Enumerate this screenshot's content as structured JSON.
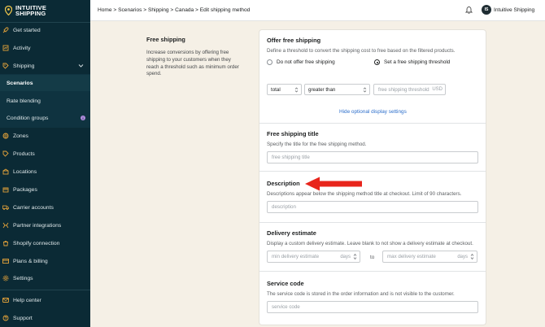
{
  "brand": {
    "line1": "INTUITIVE",
    "line2": "SHIPPING"
  },
  "sidebar": {
    "items": [
      {
        "label": "Get started",
        "icon": "rocket-icon"
      },
      {
        "label": "Activity",
        "icon": "activity-icon"
      },
      {
        "label": "Shipping",
        "icon": "shipping-icon"
      },
      {
        "label": "Scenarios"
      },
      {
        "label": "Rate blending"
      },
      {
        "label": "Condition groups",
        "badge": "i"
      },
      {
        "label": "Zones",
        "icon": "zones-icon"
      },
      {
        "label": "Products",
        "icon": "products-icon"
      },
      {
        "label": "Locations",
        "icon": "locations-icon"
      },
      {
        "label": "Packages",
        "icon": "packages-icon"
      },
      {
        "label": "Carrier accounts",
        "icon": "truck-icon"
      },
      {
        "label": "Partner integrations",
        "icon": "integrations-icon"
      },
      {
        "label": "Shopify connection",
        "icon": "shopify-icon"
      },
      {
        "label": "Plans & billing",
        "icon": "billing-icon"
      },
      {
        "label": "Settings",
        "icon": "gear-icon"
      },
      {
        "label": "Help center",
        "icon": "help-icon"
      },
      {
        "label": "Support",
        "icon": "support-icon"
      }
    ]
  },
  "topbar": {
    "breadcrumb": "Home > Scenarios > Shipping > Canada > Edit shipping method",
    "avatar_initials": "IS",
    "store_name": "Intuitive Shipping"
  },
  "info": {
    "title": "Free shipping",
    "description": "Increase conversions by offering free shipping to your customers when they reach a threshold such as minimum order spend."
  },
  "offer": {
    "title": "Offer free shipping",
    "description": "Define a threshold to convert the shipping cost to free based on the filtered products.",
    "option_none": "Do not offer free shipping",
    "option_threshold": "Set a free shipping threshold",
    "field_select": "total",
    "operator_select": "greater than",
    "threshold_placeholder": "free shipping threshold",
    "threshold_suffix": "USD",
    "optional_link": "Hide optional display settings"
  },
  "free_title": {
    "title": "Free shipping title",
    "description": "Specify the title for the free shipping method.",
    "placeholder": "free shipping title"
  },
  "description_section": {
    "title": "Description",
    "description": "Descriptions appear below the shipping method title at checkout. Limit of 90 characters.",
    "placeholder": "description"
  },
  "delivery": {
    "title": "Delivery estimate",
    "description": "Display a custom delivery estimate. Leave blank to not show a delivery estimate at checkout.",
    "min_placeholder": "min delivery estimate",
    "min_suffix": "days",
    "to_label": "to",
    "max_placeholder": "max delivery estimate",
    "max_suffix": "days"
  },
  "service": {
    "title": "Service code",
    "description": "The service code is stored in the order information and is not visible to the customer.",
    "placeholder": "service code"
  },
  "colors": {
    "sidebar": "#0b2a35",
    "accent": "#e3a23a",
    "link": "#2c6ecb",
    "background": "#f5f0e6",
    "annotation": "#e8251c"
  }
}
